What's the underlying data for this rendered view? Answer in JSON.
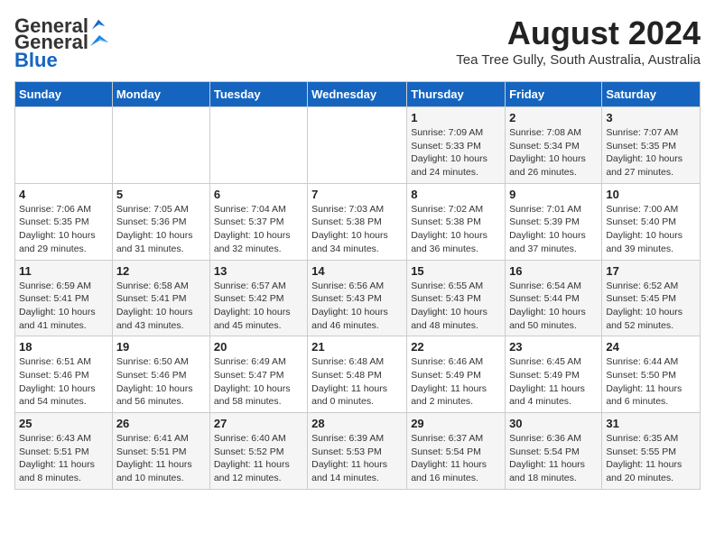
{
  "logo": {
    "general": "General",
    "blue": "Blue"
  },
  "title": "August 2024",
  "location": "Tea Tree Gully, South Australia, Australia",
  "days_of_week": [
    "Sunday",
    "Monday",
    "Tuesday",
    "Wednesday",
    "Thursday",
    "Friday",
    "Saturday"
  ],
  "weeks": [
    [
      {
        "day": "",
        "info": ""
      },
      {
        "day": "",
        "info": ""
      },
      {
        "day": "",
        "info": ""
      },
      {
        "day": "",
        "info": ""
      },
      {
        "day": "1",
        "info": "Sunrise: 7:09 AM\nSunset: 5:33 PM\nDaylight: 10 hours\nand 24 minutes."
      },
      {
        "day": "2",
        "info": "Sunrise: 7:08 AM\nSunset: 5:34 PM\nDaylight: 10 hours\nand 26 minutes."
      },
      {
        "day": "3",
        "info": "Sunrise: 7:07 AM\nSunset: 5:35 PM\nDaylight: 10 hours\nand 27 minutes."
      }
    ],
    [
      {
        "day": "4",
        "info": "Sunrise: 7:06 AM\nSunset: 5:35 PM\nDaylight: 10 hours\nand 29 minutes."
      },
      {
        "day": "5",
        "info": "Sunrise: 7:05 AM\nSunset: 5:36 PM\nDaylight: 10 hours\nand 31 minutes."
      },
      {
        "day": "6",
        "info": "Sunrise: 7:04 AM\nSunset: 5:37 PM\nDaylight: 10 hours\nand 32 minutes."
      },
      {
        "day": "7",
        "info": "Sunrise: 7:03 AM\nSunset: 5:38 PM\nDaylight: 10 hours\nand 34 minutes."
      },
      {
        "day": "8",
        "info": "Sunrise: 7:02 AM\nSunset: 5:38 PM\nDaylight: 10 hours\nand 36 minutes."
      },
      {
        "day": "9",
        "info": "Sunrise: 7:01 AM\nSunset: 5:39 PM\nDaylight: 10 hours\nand 37 minutes."
      },
      {
        "day": "10",
        "info": "Sunrise: 7:00 AM\nSunset: 5:40 PM\nDaylight: 10 hours\nand 39 minutes."
      }
    ],
    [
      {
        "day": "11",
        "info": "Sunrise: 6:59 AM\nSunset: 5:41 PM\nDaylight: 10 hours\nand 41 minutes."
      },
      {
        "day": "12",
        "info": "Sunrise: 6:58 AM\nSunset: 5:41 PM\nDaylight: 10 hours\nand 43 minutes."
      },
      {
        "day": "13",
        "info": "Sunrise: 6:57 AM\nSunset: 5:42 PM\nDaylight: 10 hours\nand 45 minutes."
      },
      {
        "day": "14",
        "info": "Sunrise: 6:56 AM\nSunset: 5:43 PM\nDaylight: 10 hours\nand 46 minutes."
      },
      {
        "day": "15",
        "info": "Sunrise: 6:55 AM\nSunset: 5:43 PM\nDaylight: 10 hours\nand 48 minutes."
      },
      {
        "day": "16",
        "info": "Sunrise: 6:54 AM\nSunset: 5:44 PM\nDaylight: 10 hours\nand 50 minutes."
      },
      {
        "day": "17",
        "info": "Sunrise: 6:52 AM\nSunset: 5:45 PM\nDaylight: 10 hours\nand 52 minutes."
      }
    ],
    [
      {
        "day": "18",
        "info": "Sunrise: 6:51 AM\nSunset: 5:46 PM\nDaylight: 10 hours\nand 54 minutes."
      },
      {
        "day": "19",
        "info": "Sunrise: 6:50 AM\nSunset: 5:46 PM\nDaylight: 10 hours\nand 56 minutes."
      },
      {
        "day": "20",
        "info": "Sunrise: 6:49 AM\nSunset: 5:47 PM\nDaylight: 10 hours\nand 58 minutes."
      },
      {
        "day": "21",
        "info": "Sunrise: 6:48 AM\nSunset: 5:48 PM\nDaylight: 11 hours\nand 0 minutes."
      },
      {
        "day": "22",
        "info": "Sunrise: 6:46 AM\nSunset: 5:49 PM\nDaylight: 11 hours\nand 2 minutes."
      },
      {
        "day": "23",
        "info": "Sunrise: 6:45 AM\nSunset: 5:49 PM\nDaylight: 11 hours\nand 4 minutes."
      },
      {
        "day": "24",
        "info": "Sunrise: 6:44 AM\nSunset: 5:50 PM\nDaylight: 11 hours\nand 6 minutes."
      }
    ],
    [
      {
        "day": "25",
        "info": "Sunrise: 6:43 AM\nSunset: 5:51 PM\nDaylight: 11 hours\nand 8 minutes."
      },
      {
        "day": "26",
        "info": "Sunrise: 6:41 AM\nSunset: 5:51 PM\nDaylight: 11 hours\nand 10 minutes."
      },
      {
        "day": "27",
        "info": "Sunrise: 6:40 AM\nSunset: 5:52 PM\nDaylight: 11 hours\nand 12 minutes."
      },
      {
        "day": "28",
        "info": "Sunrise: 6:39 AM\nSunset: 5:53 PM\nDaylight: 11 hours\nand 14 minutes."
      },
      {
        "day": "29",
        "info": "Sunrise: 6:37 AM\nSunset: 5:54 PM\nDaylight: 11 hours\nand 16 minutes."
      },
      {
        "day": "30",
        "info": "Sunrise: 6:36 AM\nSunset: 5:54 PM\nDaylight: 11 hours\nand 18 minutes."
      },
      {
        "day": "31",
        "info": "Sunrise: 6:35 AM\nSunset: 5:55 PM\nDaylight: 11 hours\nand 20 minutes."
      }
    ]
  ]
}
